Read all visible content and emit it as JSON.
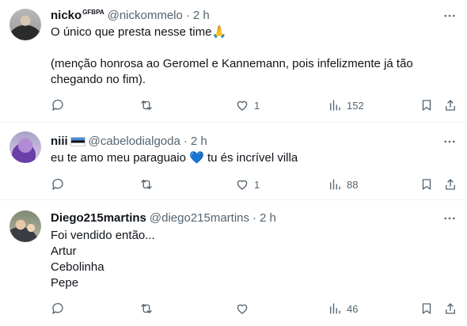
{
  "tweets": [
    {
      "name": "nicko",
      "name_sup": "GFBPA",
      "handle": "@nickommelo",
      "dot": "·",
      "time": "2 h",
      "lines": [
        "O único que presta nesse time🙏",
        "",
        "(menção honrosa ao Geromel e Kannemann, pois infelizmente já tão",
        "chegando no fim)."
      ],
      "likes": "1",
      "views": "152"
    },
    {
      "name": "niii",
      "handle": "@cabelodialgoda",
      "dot": "·",
      "time": "2 h",
      "lines": [
        "eu te amo meu paraguaio 💙 tu és incrível villa"
      ],
      "likes": "1",
      "views": "88"
    },
    {
      "name": "Diego215martins",
      "handle": "@diego215martins",
      "dot": "·",
      "time": "2 h",
      "lines": [
        "Foi vendido então...",
        "Artur",
        "Cebolinha",
        "Pepe"
      ],
      "likes": "",
      "views": "46"
    }
  ],
  "icons": [
    "more-icon",
    "reply-icon",
    "retweet-icon",
    "like-icon",
    "views-icon",
    "bookmark-icon",
    "share-icon"
  ]
}
